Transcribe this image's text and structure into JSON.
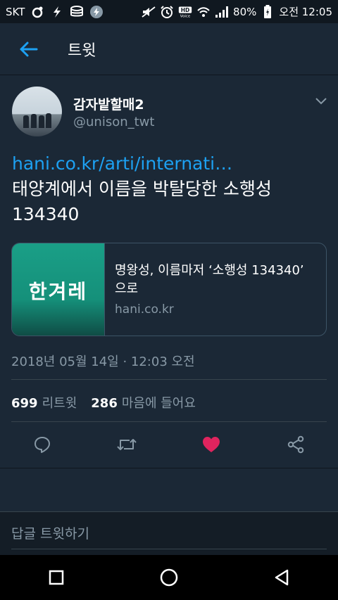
{
  "status_bar": {
    "carrier": "SKT",
    "battery": "80%",
    "time": "오전 12:05",
    "left_icons": [
      "circle-app-icon",
      "bolt-app-icon",
      "database-icon",
      "flash-icon"
    ],
    "right_icons": [
      "mute-icon",
      "alarm-icon",
      "hd-voice-icon",
      "wifi-icon",
      "signal-icon",
      "battery-icon"
    ]
  },
  "app_bar": {
    "title": "트윗"
  },
  "tweet": {
    "author_name": "감자밭할매2",
    "author_handle": "@unison_twt",
    "link_text": "hani.co.kr/arti/internati…",
    "body": "태양계에서 이름을 박탈당한 소행성 134340",
    "card": {
      "logo": "한겨레",
      "title": "명왕성, 이름마저 ‘소행성 134340’ 으로",
      "domain": "hani.co.kr"
    },
    "timestamp": "2018년 05월 14일 · 12:03 오전",
    "retweets_count": "699",
    "retweets_label": "리트윗",
    "likes_count": "286",
    "likes_label": "마음에 들어요"
  },
  "reply": {
    "placeholder": "답글 트윗하기"
  },
  "colors": {
    "accent": "#1da1f2",
    "like": "#e0245e",
    "background": "#1b2836",
    "secondary_text": "#8899a6"
  }
}
